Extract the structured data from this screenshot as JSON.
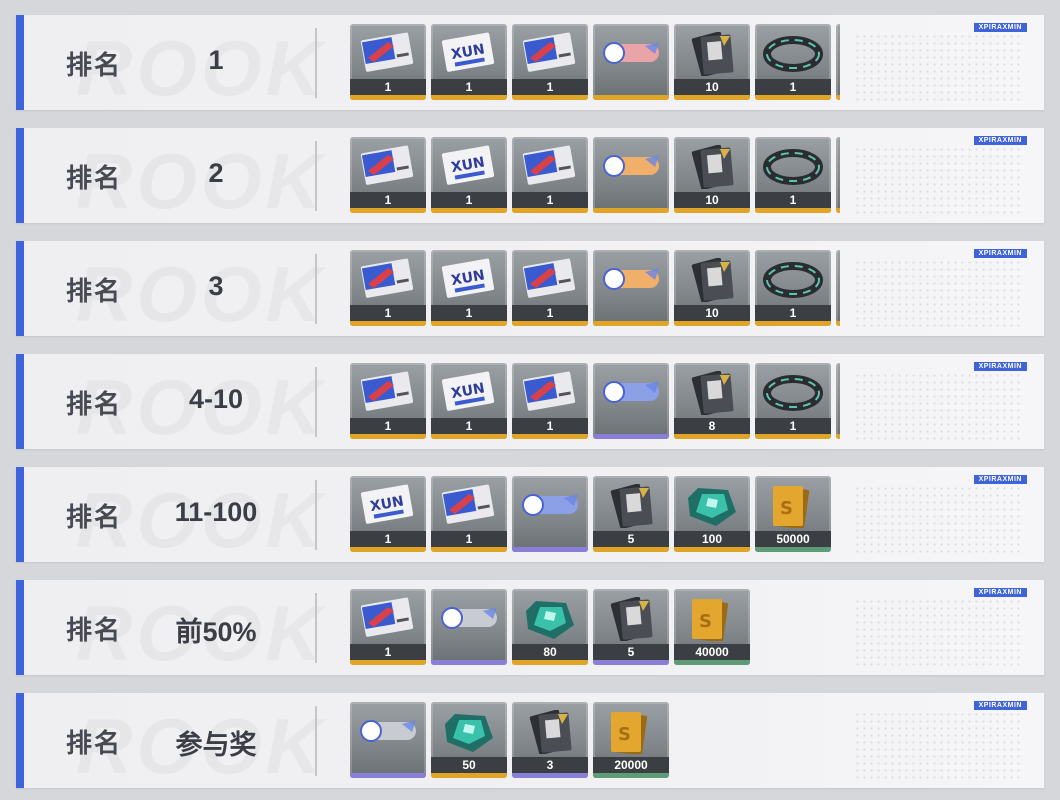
{
  "label": "排名",
  "watermark": "ROOK",
  "tag_text": "XPIRAXMIN",
  "colors": {
    "accent": "#3f63d9",
    "gold": "#e0a526",
    "purple": "#8a7fd6",
    "green": "#5e9c78",
    "blue": "#4a63d3"
  },
  "rows": [
    {
      "rank": "1",
      "items": [
        {
          "icon": "ticket-red-blue",
          "count": "1",
          "rarity": "gold"
        },
        {
          "icon": "ticket-white-blue",
          "count": "1",
          "rarity": "gold"
        },
        {
          "icon": "ticket-red-blue",
          "count": "1",
          "rarity": "gold"
        },
        {
          "icon": "nameplate-red",
          "count": "",
          "rarity": "gold"
        },
        {
          "icon": "card-pack",
          "count": "10",
          "rarity": "gold"
        },
        {
          "icon": "ring",
          "count": "1",
          "rarity": "gold"
        },
        {
          "icon": "cut-item",
          "count": "",
          "rarity": "gold"
        }
      ]
    },
    {
      "rank": "2",
      "items": [
        {
          "icon": "ticket-red-blue",
          "count": "1",
          "rarity": "gold"
        },
        {
          "icon": "ticket-white-blue",
          "count": "1",
          "rarity": "gold"
        },
        {
          "icon": "ticket-red-blue",
          "count": "1",
          "rarity": "gold"
        },
        {
          "icon": "nameplate-orange",
          "count": "",
          "rarity": "gold"
        },
        {
          "icon": "card-pack",
          "count": "10",
          "rarity": "gold"
        },
        {
          "icon": "ring",
          "count": "1",
          "rarity": "gold"
        },
        {
          "icon": "cut-item",
          "count": "",
          "rarity": "gold"
        }
      ]
    },
    {
      "rank": "3",
      "items": [
        {
          "icon": "ticket-red-blue",
          "count": "1",
          "rarity": "gold"
        },
        {
          "icon": "ticket-white-blue",
          "count": "1",
          "rarity": "gold"
        },
        {
          "icon": "ticket-red-blue",
          "count": "1",
          "rarity": "gold"
        },
        {
          "icon": "nameplate-orange",
          "count": "",
          "rarity": "gold"
        },
        {
          "icon": "card-pack",
          "count": "10",
          "rarity": "gold"
        },
        {
          "icon": "ring",
          "count": "1",
          "rarity": "gold"
        },
        {
          "icon": "cut-item",
          "count": "",
          "rarity": "gold"
        }
      ]
    },
    {
      "rank": "4-10",
      "items": [
        {
          "icon": "ticket-red-blue",
          "count": "1",
          "rarity": "gold"
        },
        {
          "icon": "ticket-white-blue",
          "count": "1",
          "rarity": "gold"
        },
        {
          "icon": "ticket-red-blue",
          "count": "1",
          "rarity": "gold"
        },
        {
          "icon": "nameplate-blue",
          "count": "",
          "rarity": "purple"
        },
        {
          "icon": "card-pack",
          "count": "8",
          "rarity": "gold"
        },
        {
          "icon": "ring",
          "count": "1",
          "rarity": "gold"
        },
        {
          "icon": "cut-item",
          "count": "",
          "rarity": "gold"
        }
      ]
    },
    {
      "rank": "11-100",
      "items": [
        {
          "icon": "ticket-white-blue",
          "count": "1",
          "rarity": "gold"
        },
        {
          "icon": "ticket-red-blue",
          "count": "1",
          "rarity": "gold"
        },
        {
          "icon": "nameplate-blue",
          "count": "",
          "rarity": "purple"
        },
        {
          "icon": "card-pack",
          "count": "5",
          "rarity": "gold"
        },
        {
          "icon": "crystal",
          "count": "100",
          "rarity": "gold"
        },
        {
          "icon": "gold-bars",
          "count": "50000",
          "rarity": "green"
        }
      ]
    },
    {
      "rank": "前50%",
      "items": [
        {
          "icon": "ticket-red-blue",
          "count": "1",
          "rarity": "gold"
        },
        {
          "icon": "nameplate-silver",
          "count": "",
          "rarity": "purple"
        },
        {
          "icon": "crystal",
          "count": "80",
          "rarity": "gold"
        },
        {
          "icon": "card-pack",
          "count": "5",
          "rarity": "purple"
        },
        {
          "icon": "gold-bars",
          "count": "40000",
          "rarity": "green"
        }
      ]
    },
    {
      "rank": "参与奖",
      "items": [
        {
          "icon": "nameplate-silver",
          "count": "",
          "rarity": "purple"
        },
        {
          "icon": "crystal",
          "count": "50",
          "rarity": "gold"
        },
        {
          "icon": "card-pack",
          "count": "3",
          "rarity": "purple"
        },
        {
          "icon": "gold-bars",
          "count": "20000",
          "rarity": "green"
        }
      ]
    }
  ]
}
